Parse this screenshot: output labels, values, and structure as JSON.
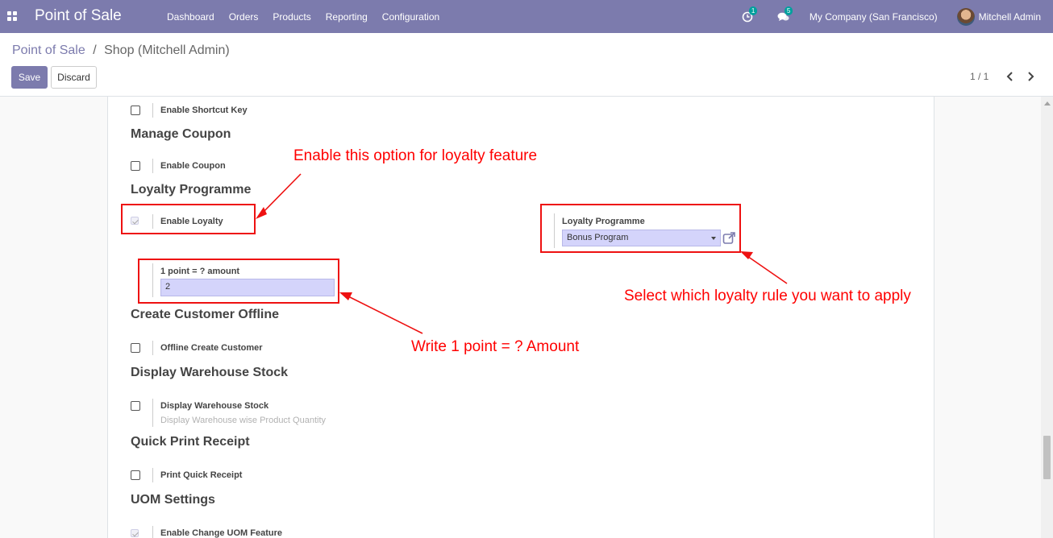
{
  "navbar": {
    "brand": "Point of Sale",
    "menu": [
      "Dashboard",
      "Orders",
      "Products",
      "Reporting",
      "Configuration"
    ],
    "activity_count": "1",
    "messages_count": "5",
    "company": "My Company (San Francisco)",
    "user": "Mitchell Admin",
    "color": "#7c7bad"
  },
  "breadcrumb": {
    "parent": "Point of Sale",
    "separator": "/",
    "current": "Shop (Mitchell Admin)"
  },
  "buttons": {
    "save": "Save",
    "discard": "Discard"
  },
  "pager": {
    "value": "1 / 1"
  },
  "form": {
    "shortcut_key_label": "Enable Shortcut Key",
    "manage_coupon_title": "Manage Coupon",
    "enable_coupon_label": "Enable Coupon",
    "loyalty_programme_title": "Loyalty Programme",
    "enable_loyalty_label": "Enable Loyalty",
    "loyalty_programme_field_label": "Loyalty Programme",
    "loyalty_programme_value": "Bonus Program",
    "point_amount_label": "1 point = ? amount",
    "point_amount_value": "2",
    "create_customer_offline_title": "Create Customer Offline",
    "offline_create_customer_label": "Offline Create Customer",
    "display_warehouse_stock_title": "Display Warehouse Stock",
    "display_warehouse_stock_label": "Display Warehouse Stock",
    "display_warehouse_stock_help": "Display Warehouse wise Product Quantity",
    "quick_print_receipt_title": "Quick Print Receipt",
    "print_quick_receipt_label": "Print Quick Receipt",
    "uom_settings_title": "UOM Settings",
    "enable_change_uom_label": "Enable Change UOM Feature",
    "enable_loyalty_checked": true,
    "enable_change_uom_checked": true
  },
  "annotations": {
    "enable_loyalty_note": "Enable this option for loyalty feature",
    "select_rule_note": "Select which loyalty rule you want to apply",
    "write_point_note": "Write 1 point = ? Amount",
    "color": "#ff0000"
  }
}
